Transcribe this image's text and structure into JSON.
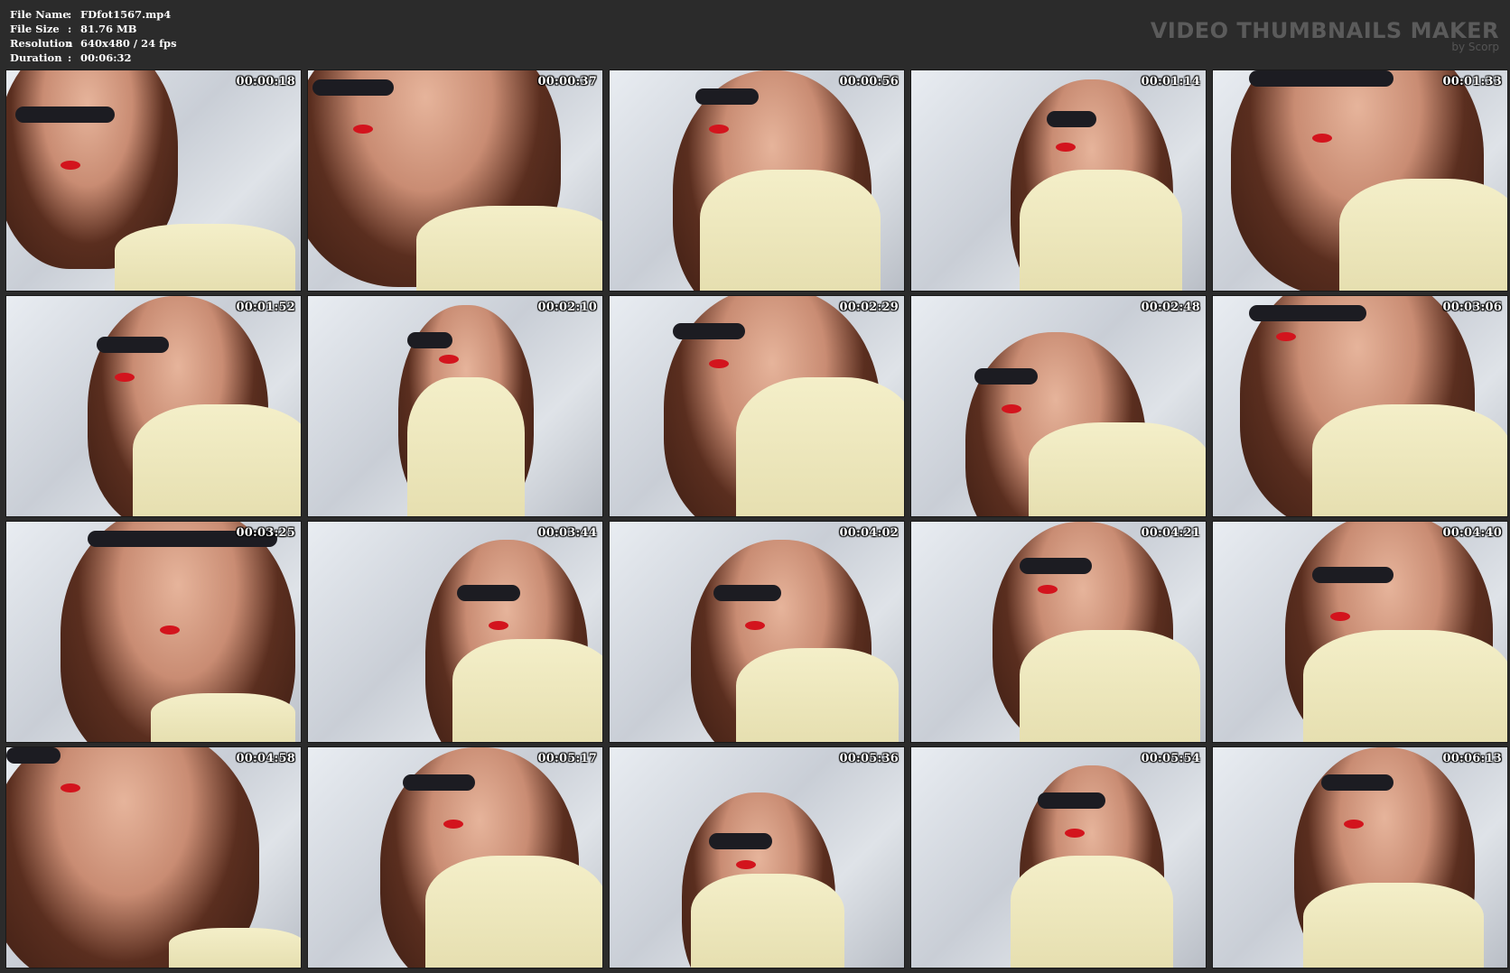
{
  "meta": {
    "rows": [
      {
        "label": "File Name",
        "sep": ":",
        "value": "FDfot1567.mp4"
      },
      {
        "label": "File Size",
        "sep": ":",
        "value": "81.76 MB"
      },
      {
        "label": "Resolution",
        "sep": ":",
        "value": "640x480 / 24 fps"
      },
      {
        "label": "Duration",
        "sep": ":",
        "value": "00:06:32"
      }
    ]
  },
  "brand": {
    "title": "VIDEO THUMBNAILS MAKER",
    "subtitle": "by Scorp"
  },
  "colors": {
    "background": "#2b2b2b",
    "meta_text": "#ffffff",
    "brand_text": "#5b5b5b",
    "lips": "#d3141d",
    "shirt": "#f4efc9"
  },
  "thumbnails": [
    {
      "timestamp": "00:00:18"
    },
    {
      "timestamp": "00:00:37"
    },
    {
      "timestamp": "00:00:56"
    },
    {
      "timestamp": "00:01:14"
    },
    {
      "timestamp": "00:01:33"
    },
    {
      "timestamp": "00:01:52"
    },
    {
      "timestamp": "00:02:10"
    },
    {
      "timestamp": "00:02:29"
    },
    {
      "timestamp": "00:02:48"
    },
    {
      "timestamp": "00:03:06"
    },
    {
      "timestamp": "00:03:25"
    },
    {
      "timestamp": "00:03:44"
    },
    {
      "timestamp": "00:04:02"
    },
    {
      "timestamp": "00:04:21"
    },
    {
      "timestamp": "00:04:40"
    },
    {
      "timestamp": "00:04:58"
    },
    {
      "timestamp": "00:05:17"
    },
    {
      "timestamp": "00:05:36"
    },
    {
      "timestamp": "00:05:54"
    },
    {
      "timestamp": "00:06:13"
    }
  ]
}
